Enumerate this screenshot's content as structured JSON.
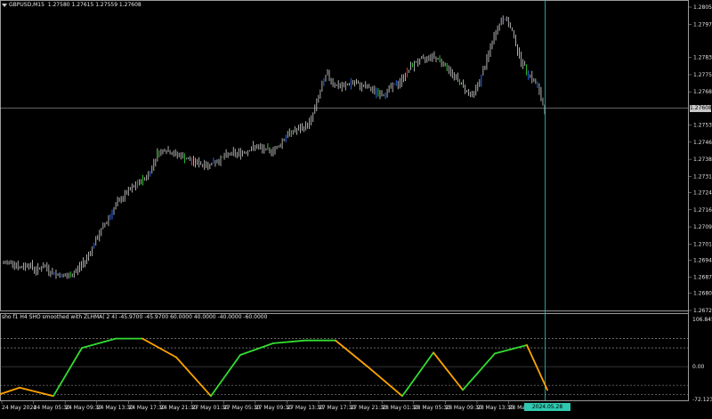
{
  "symbol_header": {
    "symbol": "GBPUSD,M15",
    "ohlc": "1.27580 1.27615 1.27559 1.27608"
  },
  "indicator": {
    "title": "sho f1  H4 SHO smoothed with ZLHMA( 2 4)  -45.9700 -45.9700 60.0000 40.0000 -40.0000 -60.0000",
    "scale_top": "106.8456",
    "scale_mid": "0.00",
    "scale_bottom": "-72.1231"
  },
  "current_price": "1.27608",
  "cursor_time_label": "2024.05.28 22:00",
  "colors": {
    "background": "#000000",
    "bull_candle": "#2f6fff",
    "bear_candle": "#ff3030",
    "neutral_candle": "#bfbfbf",
    "green_line": "#33dd33",
    "orange_line": "#ffa500",
    "cursor_line": "#2fc8b0",
    "price_line": "#c8c8c8"
  },
  "chart_data": [
    {
      "type": "candlestick",
      "title": "GBPUSD,M15",
      "y_ticks": [
        "1.28050",
        "1.27975",
        "1.27830",
        "1.27755",
        "1.27680",
        "1.27535",
        "1.27460",
        "1.27385",
        "1.27310",
        "1.27240",
        "1.27165",
        "1.27090",
        "1.27015",
        "1.26945",
        "1.26870",
        "1.26800",
        "1.26725"
      ],
      "ylim": [
        1.26725,
        1.2805
      ],
      "close_path": [
        1.2693,
        1.2694,
        1.2691,
        1.2693,
        1.269,
        1.2692,
        1.2689,
        1.2688,
        1.2687,
        1.269,
        1.2694,
        1.27,
        1.2707,
        1.2713,
        1.2719,
        1.2723,
        1.2726,
        1.2729,
        1.2732,
        1.2741,
        1.2743,
        1.2741,
        1.274,
        1.2738,
        1.2737,
        1.2736,
        1.2737,
        1.2739,
        1.2741,
        1.2741,
        1.2742,
        1.2744,
        1.2743,
        1.2742,
        1.2744,
        1.2749,
        1.2751,
        1.2752,
        1.2755,
        1.2766,
        1.2776,
        1.2771,
        1.277,
        1.2772,
        1.2771,
        1.277,
        1.2768,
        1.2767,
        1.277,
        1.2772,
        1.2777,
        1.2781,
        1.2782,
        1.2784,
        1.2782,
        1.2778,
        1.2774,
        1.277,
        1.2766,
        1.2773,
        1.2784,
        1.2795,
        1.2801,
        1.2794,
        1.2782,
        1.2776,
        1.2771,
        1.276
      ]
    },
    {
      "type": "line",
      "title": "sho f1  H4 SHO smoothed with ZLHMA( 2 4)",
      "ylim": [
        -72.1231,
        106.8456
      ],
      "levels": [
        60,
        40,
        0,
        -40,
        -60
      ],
      "x_ticks": [
        "24 May 2024",
        "24 May 05:30",
        "24 May 09:30",
        "24 May 13:30",
        "24 May 17:30",
        "24 May 21:30",
        "27 May 01:30",
        "27 May 05:30",
        "27 May 09:30",
        "27 May 13:30",
        "27 May 17:30",
        "27 May 21:30",
        "28 May 01:30",
        "28 May 05:30",
        "28 May 09:30",
        "28 May 13:30",
        "28 May 17:30",
        "28 May 22:00"
      ],
      "points": [
        [
          0,
          -59
        ],
        [
          22,
          -45
        ],
        [
          60,
          -63
        ],
        [
          92,
          40
        ],
        [
          130,
          60
        ],
        [
          160,
          60
        ],
        [
          198,
          20
        ],
        [
          237,
          -63
        ],
        [
          270,
          25
        ],
        [
          307,
          50
        ],
        [
          343,
          56
        ],
        [
          377,
          56
        ],
        [
          413,
          0
        ],
        [
          452,
          -63
        ],
        [
          487,
          30
        ],
        [
          520,
          -50
        ],
        [
          556,
          28
        ],
        [
          592,
          46
        ],
        [
          615,
          -50
        ]
      ],
      "segment_colors": [
        "orange",
        "orange",
        "green",
        "green",
        "green",
        "orange",
        "orange",
        "green",
        "green",
        "green",
        "green",
        "orange",
        "orange",
        "green",
        "orange",
        "green",
        "green",
        "orange"
      ]
    }
  ]
}
